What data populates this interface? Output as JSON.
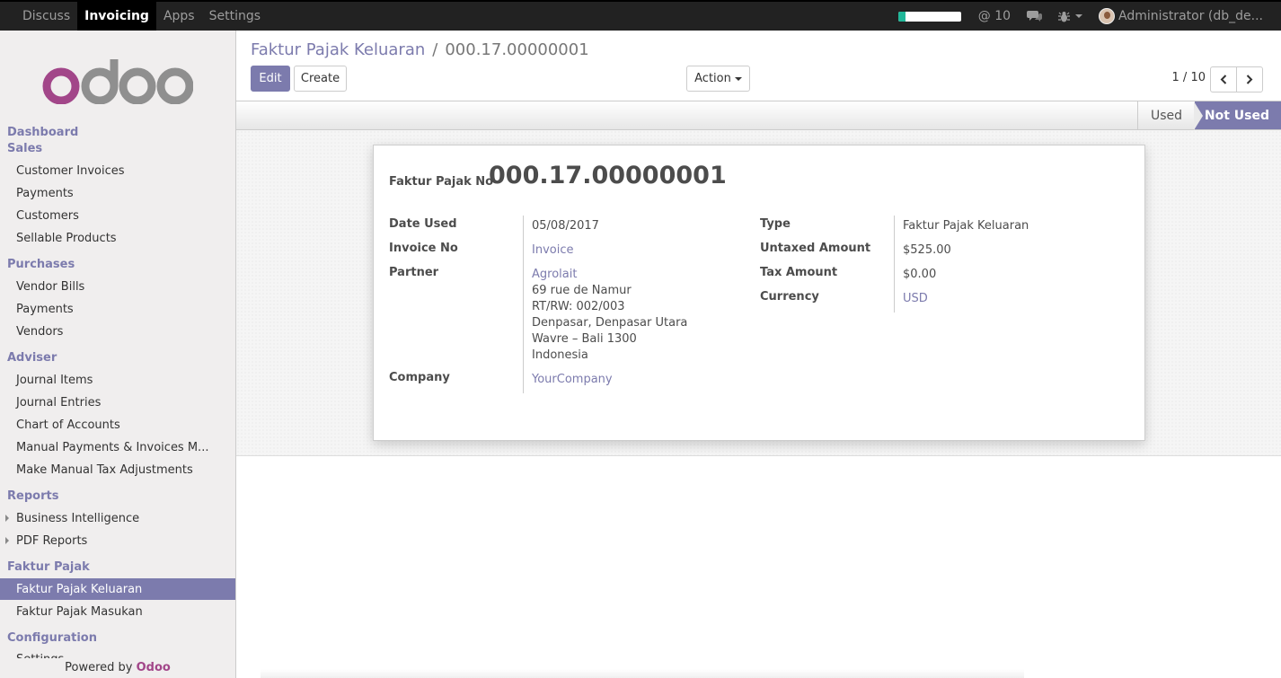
{
  "topbar": {
    "menu": [
      "Discuss",
      "Invoicing",
      "Apps",
      "Settings"
    ],
    "active_menu": "Invoicing",
    "mentions": "@ 10",
    "user": "Administrator (db_de...",
    "progress": 0.12,
    "accent": "#21b799"
  },
  "sidebar": {
    "logo_alt": "odoo",
    "sections": {
      "dashboard": "Dashboard",
      "sales": "Sales",
      "purchases": "Purchases",
      "adviser": "Adviser",
      "reports": "Reports",
      "faktur": "Faktur Pajak",
      "config": "Configuration"
    },
    "sales_items": [
      "Customer Invoices",
      "Payments",
      "Customers",
      "Sellable Products"
    ],
    "purchase_items": [
      "Vendor Bills",
      "Payments",
      "Vendors"
    ],
    "adviser_items": [
      "Journal Items",
      "Journal Entries",
      "Chart of Accounts",
      "Manual Payments & Invoices M...",
      "Make Manual Tax Adjustments"
    ],
    "report_items": [
      "Business Intelligence",
      "PDF Reports"
    ],
    "faktur_items": [
      "Faktur Pajak Keluaran",
      "Faktur Pajak Masukan"
    ],
    "config_items": [
      "Settings"
    ],
    "powered_prefix": "Powered by ",
    "powered_brand": "Odoo"
  },
  "control_panel": {
    "breadcrumb_parent": "Faktur Pajak Keluaran",
    "breadcrumb_sep": "/",
    "breadcrumb_current": "000.17.00000001",
    "edit_label": "Edit",
    "create_label": "Create",
    "action_label": "Action",
    "pager": "1 / 10"
  },
  "status": {
    "used": "Used",
    "not_used": "Not Used"
  },
  "form": {
    "title_label": "Faktur Pajak No",
    "title_value": "000.17.00000001",
    "date_used_label": "Date Used",
    "date_used": "05/08/2017",
    "invoice_no_label": "Invoice No",
    "invoice_no": "Invoice",
    "partner_label": "Partner",
    "partner_name": "Agrolait",
    "partner_addr1": "69 rue de Namur",
    "partner_addr2": "RT/RW: 002/003",
    "partner_addr3": "Denpasar, Denpasar Utara",
    "partner_addr4": "Wavre – Bali 1300",
    "partner_addr5": "Indonesia",
    "company_label": "Company",
    "company": "YourCompany",
    "type_label": "Type",
    "type": "Faktur Pajak Keluaran",
    "untaxed_label": "Untaxed Amount",
    "untaxed": "$525.00",
    "tax_label": "Tax Amount",
    "tax": "$0.00",
    "currency_label": "Currency",
    "currency": "USD"
  },
  "colors": {
    "brand": "#7c7bad",
    "logo_o": "#a24689"
  }
}
